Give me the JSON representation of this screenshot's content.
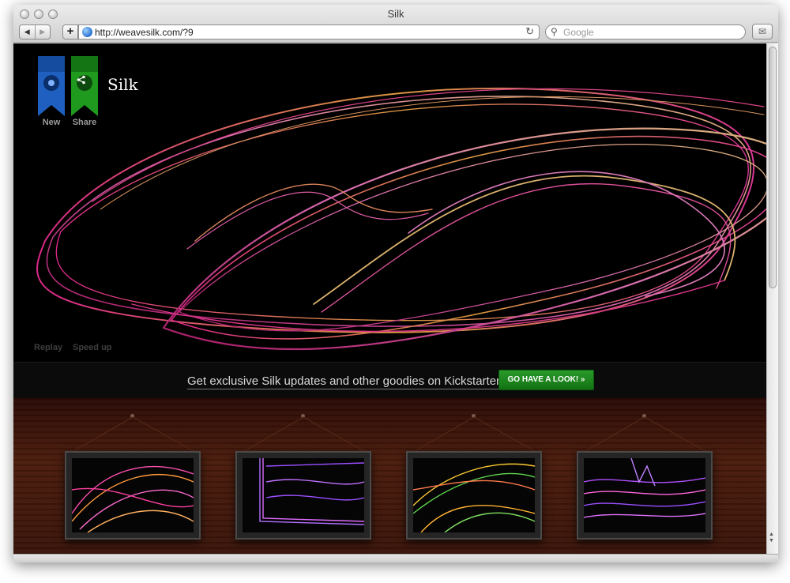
{
  "window": {
    "title": "Silk"
  },
  "toolbar": {
    "back_icon": "back-arrow-icon",
    "forward_icon": "forward-arrow-icon",
    "add_icon": "plus-icon",
    "url": "http://weavesilk.com/?9",
    "reload_icon": "reload-icon",
    "search_placeholder": "Google"
  },
  "app": {
    "ribbons": [
      {
        "label": "New",
        "icon": "new-icon",
        "color": "#1e5fbf"
      },
      {
        "label": "Share",
        "icon": "share-icon",
        "color": "#1f9a1f"
      }
    ],
    "logo": "Silk",
    "replay": "Replay",
    "speed_up": "Speed up"
  },
  "promo": {
    "text": "Get exclusive Silk updates and other goodies on Kickstarter!",
    "button": "GO HAVE A LOOK! »"
  },
  "gallery": {
    "frames": [
      {
        "palette": [
          "#ff4fb0",
          "#ff9a3c"
        ]
      },
      {
        "palette": [
          "#9a4fff",
          "#e06bff"
        ]
      },
      {
        "palette": [
          "#ffcc33",
          "#5fd44f"
        ]
      },
      {
        "palette": [
          "#b04fff",
          "#ff66dd"
        ]
      }
    ]
  },
  "colors": {
    "accent_green": "#1f9a1f",
    "accent_blue": "#1e5fbf",
    "background": "#000000"
  }
}
